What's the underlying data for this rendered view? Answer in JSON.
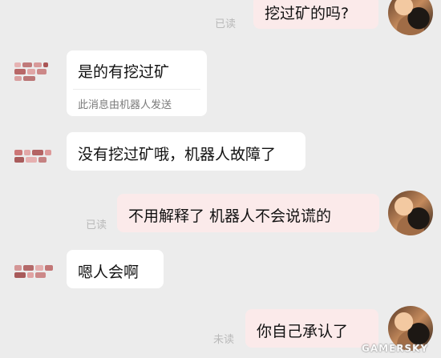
{
  "messages": [
    {
      "side": "right",
      "text": "挖过矿的吗?",
      "status": "已读"
    },
    {
      "side": "left",
      "text": "是的有挖过矿",
      "note": "此消息由机器人发送"
    },
    {
      "side": "left",
      "text": "没有挖过矿哦，机器人故障了"
    },
    {
      "side": "right",
      "text": "不用解释了 机器人不会说谎的",
      "status": "已读"
    },
    {
      "side": "left",
      "text": "嗯人会啊"
    },
    {
      "side": "right",
      "text": "你自己承认了",
      "status": "未读"
    }
  ],
  "watermark": "GAMERSKY",
  "colors": {
    "background": "#ececec",
    "incoming_bubble": "#ffffff",
    "outgoing_bubble": "#fbeaea",
    "status_text": "#b9b9b9"
  }
}
